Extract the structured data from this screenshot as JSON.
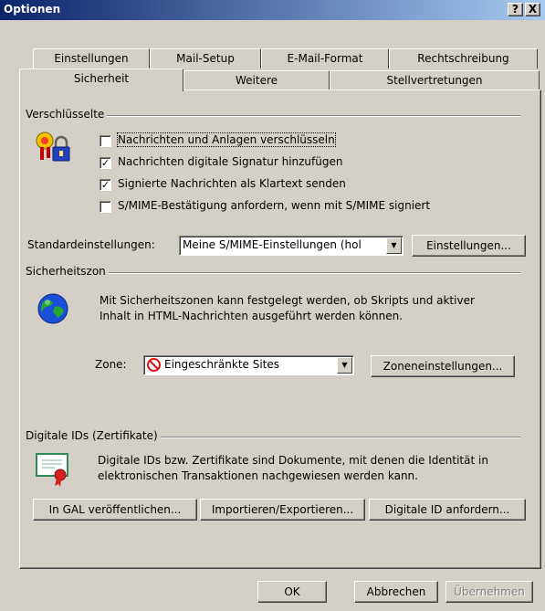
{
  "window": {
    "title": "Optionen",
    "help_button": "?",
    "close_button": "X"
  },
  "tabs_row1": [
    "Einstellungen",
    "Mail-Setup",
    "E-Mail-Format",
    "Rechtschreibung"
  ],
  "tabs_row2": [
    "Sicherheit",
    "Weitere",
    "Stellvertretungen"
  ],
  "encryption": {
    "group_label": "Verschlüsselte",
    "options": [
      {
        "label": "Nachrichten und Anlagen verschlüsseln",
        "checked": false
      },
      {
        "label": "Nachrichten digitale Signatur hinzufügen",
        "checked": true
      },
      {
        "label": "Signierte Nachrichten als Klartext senden",
        "checked": true
      },
      {
        "label": "S/MIME-Bestätigung anfordern, wenn mit S/MIME signiert",
        "checked": false
      }
    ],
    "default_label": "Standardeinstellungen:",
    "default_value": "Meine S/MIME-Einstellungen (hol",
    "settings_button": "Einstellungen..."
  },
  "zones": {
    "group_label": "Sicherheitszon",
    "description_line1": "Mit Sicherheitszonen kann festgelegt werden, ob Skripts und aktiver",
    "description_line2": "Inhalt in HTML-Nachrichten ausgeführt werden können.",
    "zone_label": "Zone:",
    "zone_value": "Eingeschränkte Sites",
    "zone_settings_button": "Zoneneinstellungen..."
  },
  "digital_ids": {
    "group_label": "Digitale IDs (Zertifikate)",
    "description_line1": "Digitale IDs bzw. Zertifikate sind Dokumente, mit denen die Identität in",
    "description_line2": "elektronischen Transaktionen nachgewiesen werden kann.",
    "publish_button": "In GAL veröffentlichen...",
    "import_export_button": "Importieren/Exportieren...",
    "request_button": "Digitale ID anfordern..."
  },
  "footer": {
    "ok": "OK",
    "cancel": "Abbrechen",
    "apply": "Übernehmen"
  },
  "colors": {
    "titlebar_start": "#0a246a",
    "titlebar_end": "#a6caf0",
    "face": "#d4d0c8"
  }
}
